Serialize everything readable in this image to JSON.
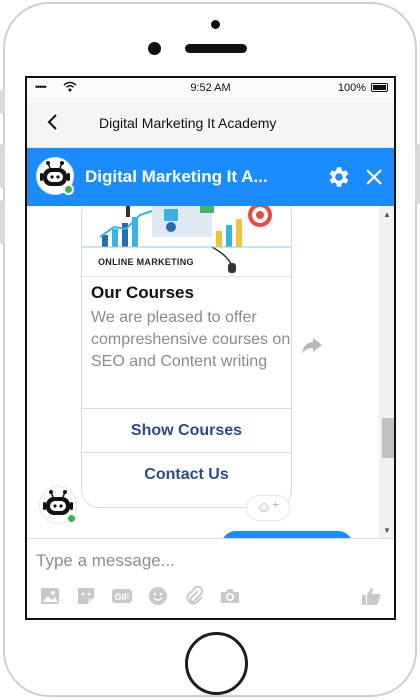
{
  "status_bar": {
    "signal": "•••••",
    "time": "9:52 AM",
    "battery": "100%"
  },
  "nav": {
    "title": "Digital Marketing It Academy"
  },
  "chat_header": {
    "title": "Digital Marketing It A..."
  },
  "card": {
    "image_caption": "ONLINE MARKETING",
    "title": "Our Courses",
    "subtitle": "We are pleased to offer compreshensive courses on SEO and Content writing",
    "buttons": [
      "Show Courses",
      "Contact Us"
    ]
  },
  "composer": {
    "placeholder": "Type a message..."
  },
  "colors": {
    "brand": "#1a8cff",
    "button_text": "#2a4b8d",
    "online": "#3bb54a"
  }
}
